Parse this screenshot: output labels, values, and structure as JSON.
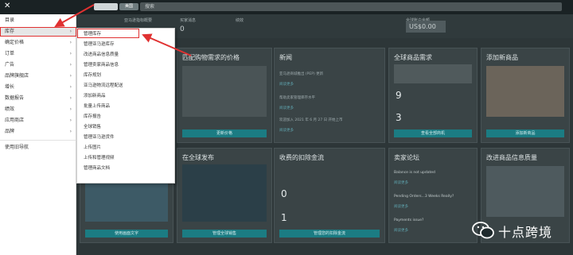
{
  "topbar": {
    "badge": "美国",
    "search_placeholder": "搜索"
  },
  "stats": {
    "items": [
      {
        "label": "亚马逊指标概要",
        "value": ""
      },
      {
        "label": "买家消息",
        "value": "0"
      },
      {
        "label": "绩效",
        "value": ""
      },
      {
        "label": "全球账户余额",
        "value": "US$0.00"
      }
    ]
  },
  "sidebar": {
    "items": [
      {
        "label": "目录",
        "chevron": ""
      },
      {
        "label": "库存",
        "chevron": "›"
      },
      {
        "label": "确定价格",
        "chevron": "›"
      },
      {
        "label": "订单",
        "chevron": "›"
      },
      {
        "label": "广告",
        "chevron": "›"
      },
      {
        "label": "品牌旗舰店",
        "chevron": "›"
      },
      {
        "label": "增长",
        "chevron": "›"
      },
      {
        "label": "数据报告",
        "chevron": "›"
      },
      {
        "label": "绩效",
        "chevron": "›"
      },
      {
        "label": "应用商店",
        "chevron": "›"
      },
      {
        "label": "品牌",
        "chevron": "›"
      }
    ],
    "footer": "使用旧导航"
  },
  "submenu": {
    "items": [
      "管理库存",
      "管理亚马逊库存",
      "改进商品信息质量",
      "管理卖家商品信息",
      "库存规划",
      "亚马逊物流远程配送",
      "添加新商品",
      "批量上传商品",
      "库存报告",
      "全球销售",
      "管理亚马逊货件",
      "上传图片",
      "上传和管理视频",
      "管理商品文档"
    ]
  },
  "cards": {
    "c1": {
      "title": "匹配购物需求的价格",
      "button": "更新价格"
    },
    "c2": {
      "title": "新闻",
      "lines": [
        "亚马逊商城推出 (PEP) 更新",
        "阅读更多",
        "帮助卖家管理库存水平",
        "阅读更多",
        "欢迎加入 2021 年 6 月 27 日 开始上市"
      ],
      "link": "阅读更多"
    },
    "c3": {
      "title": "全球商品需求",
      "n1": "9",
      "n2": "3",
      "button": "查看全部商机"
    },
    "c4": {
      "title": "添加新商品",
      "button": "添加新商品"
    },
    "c5": {
      "title": "在全球发布",
      "button": "管理全球销售"
    },
    "c6": {
      "title": "收费的扣除金流",
      "n1": "0",
      "n2": "1",
      "button": "管理您的扣除金流"
    },
    "c7": {
      "title": "卖家论坛",
      "lines": [
        "Balance is not updated",
        "阅读更多",
        "Pending Orders...3 Weeks Really?",
        "阅读更多",
        "Payments issue?"
      ],
      "link": "阅读更多"
    },
    "c8": {
      "title": "改进商品信息质量",
      "button": "修复商品信息"
    },
    "c0": {
      "button": "使用画面文字"
    }
  },
  "watermark": {
    "text": "十点跨境"
  },
  "colors": {
    "accent": "#1b7c83",
    "highlight": "#e03131"
  }
}
